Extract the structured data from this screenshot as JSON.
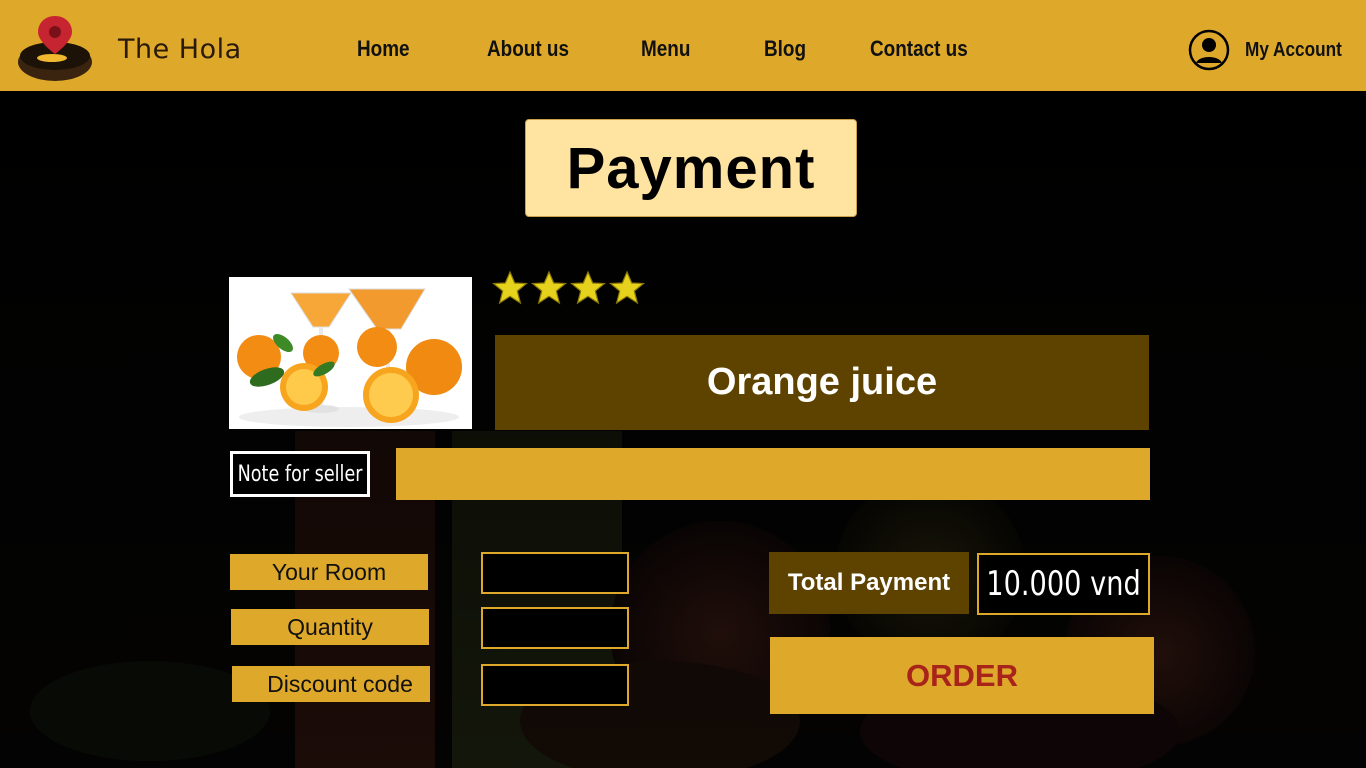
{
  "header": {
    "brand": "The Hola",
    "logo_icon": "bowl-with-location-pin-icon",
    "nav": [
      {
        "label": "Home"
      },
      {
        "label": "About us"
      },
      {
        "label": "Menu"
      },
      {
        "label": "Blog"
      },
      {
        "label": "Contact us"
      }
    ],
    "account_label": "My Account",
    "account_icon": "user-circle-icon"
  },
  "page": {
    "title": "Payment"
  },
  "product": {
    "name": "Orange juice",
    "image": "orange-juice-photo",
    "rating": 4
  },
  "note": {
    "label": "Note for seller",
    "value": ""
  },
  "form": {
    "room_label": "Your Room",
    "room_value": "",
    "quantity_label": "Quantity",
    "quantity_value": "",
    "discount_label": "Discount code",
    "discount_value": ""
  },
  "total": {
    "label": "Total Payment",
    "value": "10.000 vnd"
  },
  "order_button": "ORDER",
  "colors": {
    "accent": "#DEA82A",
    "dark_brown": "#5e4300",
    "order_text": "#A8241A",
    "title_bg": "#FFE3A0"
  }
}
